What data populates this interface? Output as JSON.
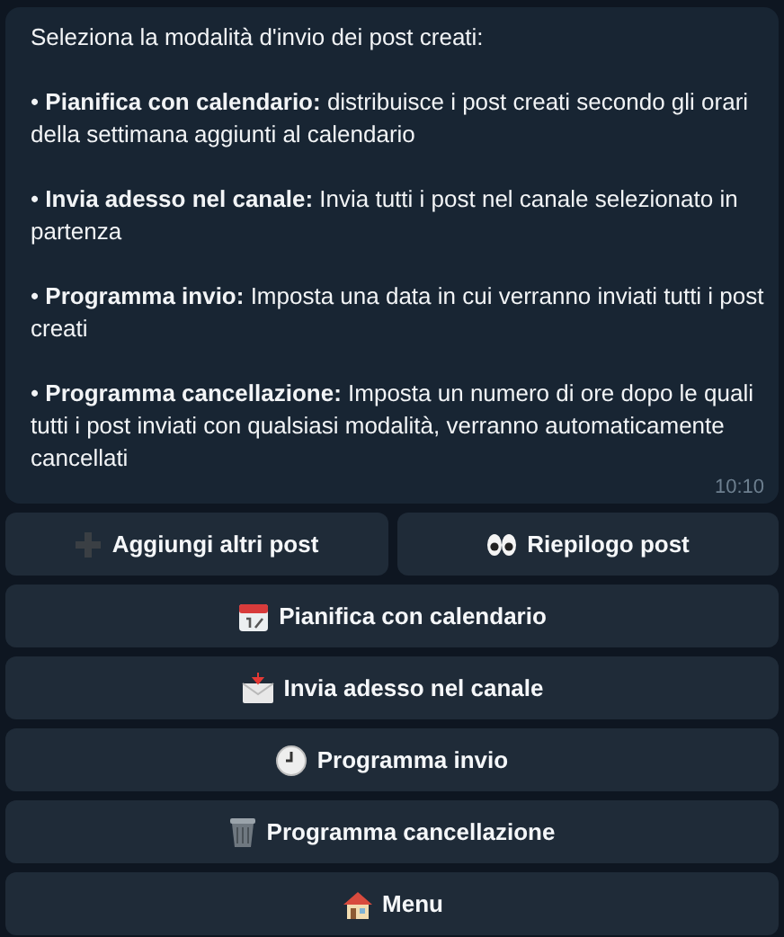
{
  "message": {
    "intro": "Seleziona la modalità d'invio dei post creati:",
    "items": [
      "• **Pianifica con calendario:** distribuisce i post creati secondo gli orari della settimana aggiunti al calendario",
      "• **Invia adesso nel canale:** Invia tutti i post nel canale selezionato in partenza",
      "• **Programma invio:** Imposta una data in cui verranno inviati tutti i post creati",
      "• **Programma cancellazione:** Imposta un numero di ore dopo le quali tutti i post inviati con qualsiasi modalità, verranno automaticamente cancellati"
    ],
    "time": "10:10"
  },
  "keyboard": [
    [
      {
        "label": "Aggiungi altri post"
      },
      {
        "label": "Riepilogo post"
      }
    ],
    [
      {
        "label": "Pianifica con calendario"
      }
    ],
    [
      {
        "label": "Invia adesso nel canale"
      }
    ],
    [
      {
        "label": "Programma invio"
      }
    ],
    [
      {
        "label": "Programma cancellazione"
      }
    ],
    [
      {
        "label": "Menu"
      }
    ]
  ]
}
